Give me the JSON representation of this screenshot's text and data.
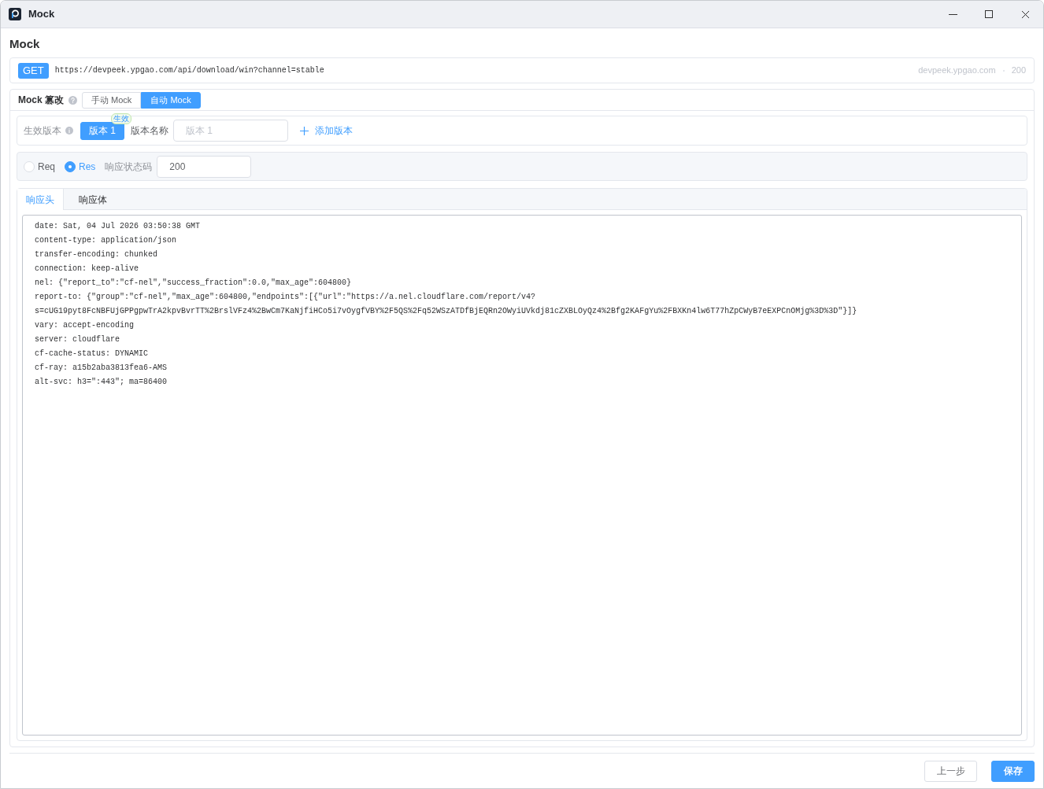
{
  "window": {
    "title": "Mock"
  },
  "page_title": "Mock",
  "request": {
    "method": "GET",
    "url": "https://devpeek.ypgao.com/api/download/win?channel=stable",
    "host": "devpeek.ypgao.com",
    "status": "200"
  },
  "mock": {
    "title": "Mock 篡改",
    "modes": [
      {
        "label": "手动 Mock",
        "selected": false
      },
      {
        "label": "自动 Mock",
        "selected": true
      }
    ],
    "version_row": {
      "label": "生效版本",
      "versions": [
        {
          "label": "版本 1",
          "badge": "生效",
          "selected": true
        }
      ],
      "name_label": "版本名称",
      "name_field": {
        "placeholder": "版本 1"
      },
      "add_button": "添加版本"
    },
    "target": {
      "options": [
        {
          "label": "Req",
          "selected": false
        },
        {
          "label": "Res",
          "selected": true
        }
      ],
      "status_label": "响应状态码",
      "status_field": {
        "value": "200"
      }
    },
    "tabs": [
      {
        "label": "响应头",
        "selected": true
      },
      {
        "label": "响应体",
        "selected": false
      }
    ],
    "editor": {
      "lines": [
        "date: Sat, 04 Jul 2026 03:50:38 GMT",
        "content-type: application/json",
        "transfer-encoding: chunked",
        "connection: keep-alive",
        "nel: {\"report_to\":\"cf-nel\",\"success_fraction\":0.0,\"max_age\":604800}",
        "report-to: {\"group\":\"cf-nel\",\"max_age\":604800,\"endpoints\":[{\"url\":\"https://a.nel.cloudflare.com/report/v4?s=cUG19pyt8FcNBFUjGPPgpwTrA2kpvBvrTT%2BrslVFz4%2BwCm7KaNjfiHCo5i7vOygfVBY%2F5QS%2Fq52WSzATDfBjEQRn2OWyiUVkdj81cZXBLOyQz4%2Bfg2KAFgYu%2FBXKn4lw6T77hZpCWyB7eEXPCnOMjg%3D%3D\"}]}",
        "vary: accept-encoding",
        "server: cloudflare",
        "cf-cache-status: DYNAMIC",
        "cf-ray: a15b2aba3813fea6-AMS",
        "alt-svc: h3=\":443\"; ma=86400"
      ]
    }
  },
  "footer": {
    "buttons": [
      {
        "label": "上一步",
        "kind": "secondary"
      },
      {
        "label": "保存",
        "kind": "primary"
      }
    ]
  }
}
